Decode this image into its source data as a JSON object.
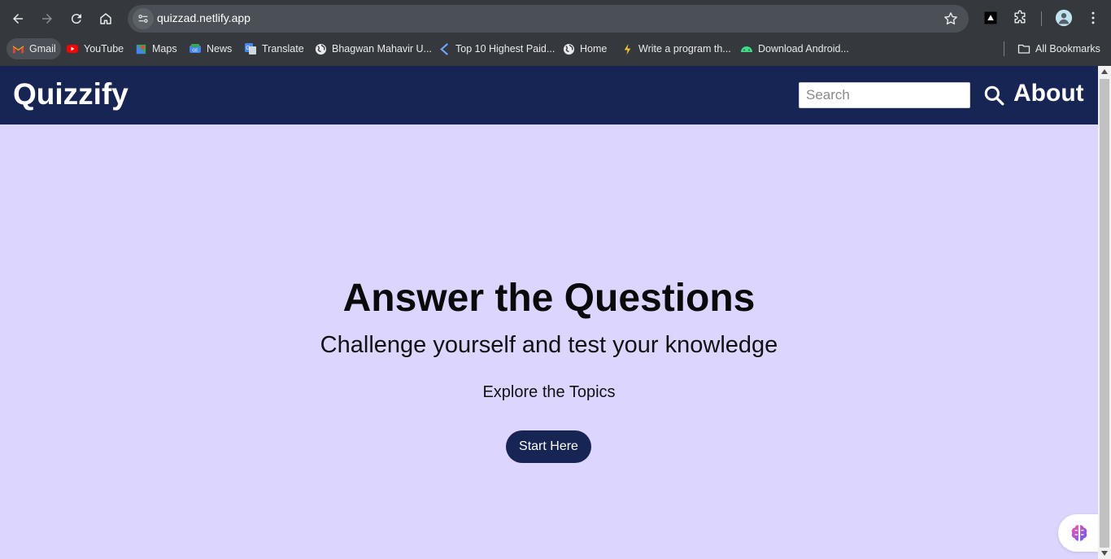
{
  "browser": {
    "url": "quizzad.netlify.app",
    "bookmarks": [
      {
        "label": "Gmail",
        "icon": "gmail-icon"
      },
      {
        "label": "YouTube",
        "icon": "youtube-icon"
      },
      {
        "label": "Maps",
        "icon": "maps-icon"
      },
      {
        "label": "News",
        "icon": "news-icon"
      },
      {
        "label": "Translate",
        "icon": "translate-icon"
      },
      {
        "label": "Bhagwan Mahavir U...",
        "icon": "globe-icon"
      },
      {
        "label": "Top 10 Highest Paid...",
        "icon": "kotlin-icon"
      },
      {
        "label": "Home",
        "icon": "globe-icon"
      },
      {
        "label": "Write a program th...",
        "icon": "bolt-icon"
      },
      {
        "label": "Download Android...",
        "icon": "android-icon"
      }
    ],
    "all_bookmarks": "All Bookmarks"
  },
  "header": {
    "brand": "Quizzify",
    "search_placeholder": "Search",
    "about": "About"
  },
  "hero": {
    "title": "Answer the Questions",
    "subtitle": "Challenge yourself and test your knowledge",
    "explore": "Explore the Topics",
    "cta": "Start Here"
  },
  "colors": {
    "header_bg": "#172554",
    "page_bg": "#dcd6ff",
    "button_bg": "#172554"
  }
}
